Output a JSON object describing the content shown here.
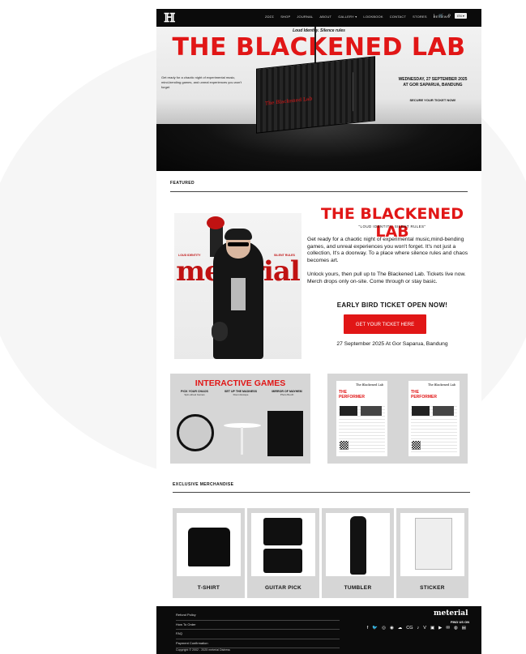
{
  "nav": {
    "logo": "ℍ",
    "links": [
      "ΖΩΣΣ",
      "SHOP",
      "JOURNAL",
      "ABOUT",
      "GALLERY ▾",
      "LOOKBOOK",
      "CONTACT",
      "STORES",
      "REVIEWS"
    ],
    "cart_icon": "cart-icon",
    "search_icon": "search-icon",
    "language": "EN ▾"
  },
  "hero": {
    "subtitle": "Loud Identity. Silence rules",
    "title": "THE BLACKENED LAB",
    "description": "Get ready for a chaotic night of experimental music, mind-bending games, and unreal experiences you won't forget",
    "date_line1": "WEDNESDAY, 27 SEPTEMBER 2025",
    "date_line2": "AT GOR SAPARUA, BANDUNG",
    "cta": "SECURE YOUR TICKET NOW!",
    "container_logo": "The Blackened Lab"
  },
  "featured": {
    "section_label": "FEATURED",
    "photo_brand": "meterial",
    "photo_tag_left": "LOUD IDENTITY",
    "photo_tag_right": "SILENT RULES",
    "title": "THE BLACKENED LAB",
    "tagline": "\"LOUD IDENTITY, SILENT RULES\"",
    "paragraph1": "Get ready for a chaotic night of experimental music,mind-bending games, and unreal experiences you won't forget. It's not just a collection, It's a doorway. To a place where silence rules and chaos becomes art.",
    "paragraph2": "Unlock yours, then pull up to The Blackened Lab. Tickets live now. Merch drops only on-site. Come through or stay basic.",
    "early_bird": "EARLY BIRD TICKET OPEN NOW!",
    "button_label": "GET YOUR TICKET HERE",
    "event_date": "27 September 2025 At Gor Saparua, Bandung"
  },
  "games": {
    "title": "INTERACTIVE GAMES",
    "items": [
      {
        "label": "PICK YOUR CHAOS",
        "sub": "Spin-wheel Games"
      },
      {
        "label": "SET UP THE MADNESS",
        "sub": "Room Escape"
      },
      {
        "label": "MIRROR OF MAYHEM",
        "sub": "Photo Booth"
      }
    ]
  },
  "performers": {
    "cards": [
      {
        "heading_line1": "THE",
        "heading_line2": "PERFORMER",
        "brand": "The Blackened Lab"
      },
      {
        "heading_line1": "THE",
        "heading_line2": "PERFORMER",
        "brand": "The Blackened Lab"
      }
    ]
  },
  "merch": {
    "section_label": "EXCLUSIVE MERCHANDISE",
    "items": [
      {
        "label": "T-SHIRT"
      },
      {
        "label": "GUITAR PICK"
      },
      {
        "label": "TUMBLER"
      },
      {
        "label": "STICKER"
      }
    ]
  },
  "footer": {
    "links": [
      "Refund Policy",
      "How To Order",
      "FAQ",
      "Payment Confirmation"
    ],
    "copyright": "Copyright © 2002 - 2025 meterial Distress",
    "brand": "meterial",
    "find_us": "FIND US ON",
    "social_icons": [
      "f",
      "🐦",
      "◎",
      "◉",
      "☁",
      "CG",
      "♪",
      "V",
      "▣",
      "▶",
      "✉",
      "◍",
      "▤"
    ]
  },
  "colors": {
    "accent": "#e11616",
    "nav_bg": "#0b0b0b",
    "card_bg": "#d6d6d6"
  }
}
